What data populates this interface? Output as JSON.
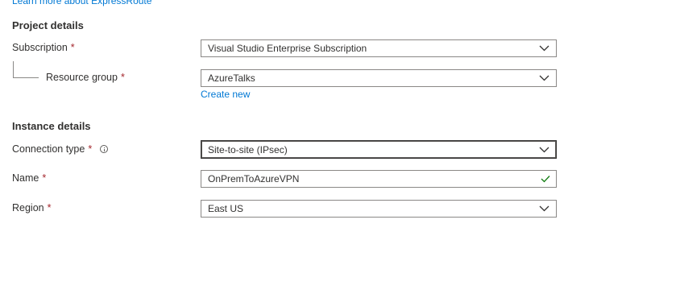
{
  "header": {
    "learn_more_link": "Learn more about ExpressRoute"
  },
  "project_details": {
    "heading": "Project details",
    "subscription": {
      "label": "Subscription",
      "required_mark": "*",
      "value": "Visual Studio Enterprise Subscription"
    },
    "resource_group": {
      "label": "Resource group",
      "required_mark": "*",
      "value": "AzureTalks",
      "create_new_link": "Create new"
    }
  },
  "instance_details": {
    "heading": "Instance details",
    "connection_type": {
      "label": "Connection type",
      "required_mark": "*",
      "value": "Site-to-site (IPsec)"
    },
    "name": {
      "label": "Name",
      "required_mark": "*",
      "value": "OnPremToAzureVPN"
    },
    "region": {
      "label": "Region",
      "required_mark": "*",
      "value": "East US"
    }
  },
  "colors": {
    "accent": "#0078d4",
    "required": "#a4262c",
    "valid": "#107c10",
    "text": "#323130",
    "border": "#8a8886"
  },
  "icons": {
    "dropdown": "chevron-down-icon",
    "info": "info-icon",
    "valid": "checkmark-icon"
  }
}
